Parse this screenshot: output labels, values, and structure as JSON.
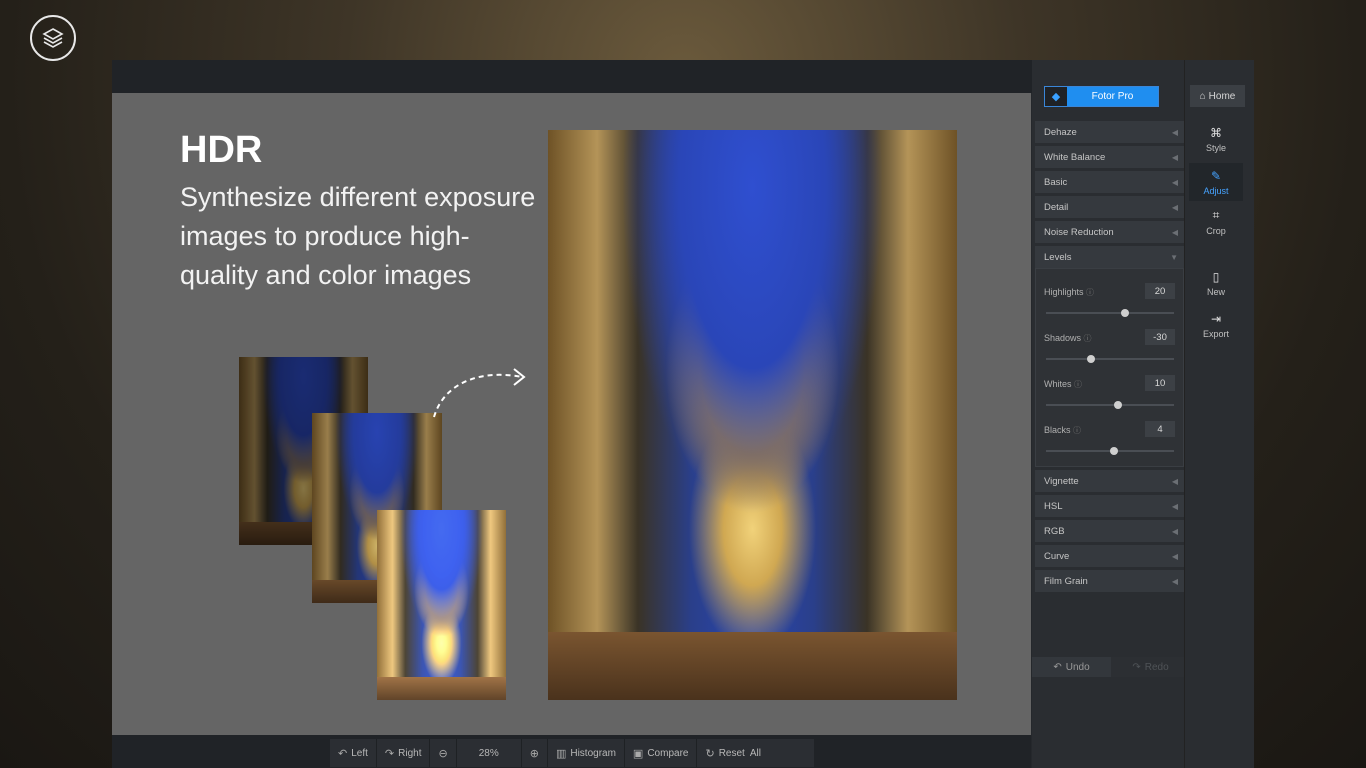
{
  "hero": {
    "title": "HDR",
    "description": "Synthesize different exposure images to produce high-quality and color images"
  },
  "header": {
    "pro_label": "Fotor Pro",
    "home_label": "Home"
  },
  "adjust_panel": {
    "sections_top": [
      "Dehaze",
      "White Balance",
      "Basic",
      "Detail",
      "Noise Reduction",
      "Levels"
    ],
    "levels": [
      {
        "label": "Highlights",
        "value": "20",
        "position": 0.62
      },
      {
        "label": "Shadows",
        "value": "-30",
        "position": 0.35
      },
      {
        "label": "Whites",
        "value": "10",
        "position": 0.56
      },
      {
        "label": "Blacks",
        "value": "4",
        "position": 0.53
      }
    ],
    "sections_bottom": [
      "Vignette",
      "HSL",
      "RGB",
      "Curve",
      "Film Grain"
    ],
    "undo_label": "Undo",
    "redo_label": "Redo"
  },
  "rail": {
    "style_label": "Style",
    "adjust_label": "Adjust",
    "crop_label": "Crop",
    "new_label": "New",
    "export_label": "Export"
  },
  "toolbar": {
    "left_label": "Left",
    "right_label": "Right",
    "zoom_label": "28%",
    "histogram_label": "Histogram",
    "compare_label": "Compare",
    "reset_label": "Reset  All"
  },
  "colors": {
    "accent": "#1f8ef0",
    "active_tab": "#46a3ff"
  }
}
